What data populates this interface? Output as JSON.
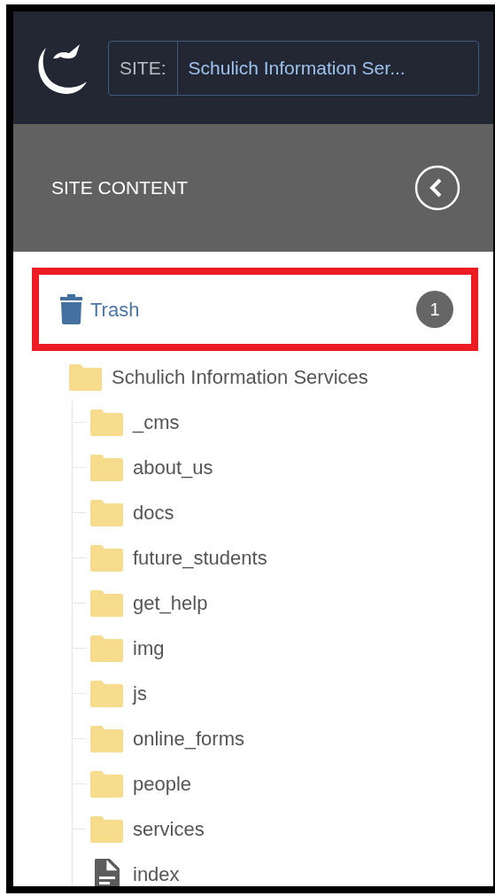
{
  "site": {
    "label": "SITE:",
    "value": "Schulich Information Ser..."
  },
  "panel": {
    "title": "SITE CONTENT"
  },
  "trash": {
    "label": "Trash",
    "count": "1",
    "highlighted": true
  },
  "tree": [
    {
      "name": "Schulich Information Services",
      "kind": "folder",
      "children": [
        {
          "name": "_cms",
          "kind": "folder"
        },
        {
          "name": "about_us",
          "kind": "folder"
        },
        {
          "name": "docs",
          "kind": "folder"
        },
        {
          "name": "future_students",
          "kind": "folder"
        },
        {
          "name": "get_help",
          "kind": "folder"
        },
        {
          "name": "img",
          "kind": "folder"
        },
        {
          "name": "js",
          "kind": "folder"
        },
        {
          "name": "online_forms",
          "kind": "folder"
        },
        {
          "name": "people",
          "kind": "folder"
        },
        {
          "name": "services",
          "kind": "folder"
        },
        {
          "name": "index",
          "kind": "file"
        }
      ]
    }
  ]
}
